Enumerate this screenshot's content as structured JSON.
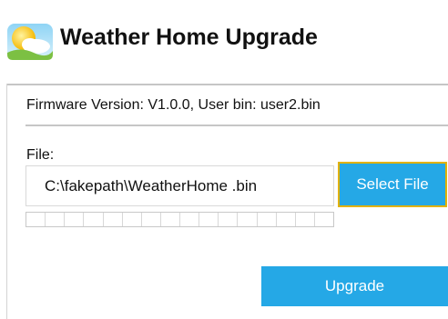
{
  "header": {
    "icon": "weather-sun-cloud-icon",
    "title": "Weather Home Upgrade"
  },
  "firmware": {
    "info": "Firmware Version: V1.0.0, User bin: user2.bin"
  },
  "file": {
    "label": "File:",
    "path": "C:\\fakepath\\WeatherHome .bin",
    "select_button": "Select File"
  },
  "progress": {
    "value": 0,
    "segments": 16
  },
  "actions": {
    "upgrade_button": "Upgrade"
  },
  "colors": {
    "accent": "#25a8e6",
    "focus_outline": "#e2b200"
  }
}
